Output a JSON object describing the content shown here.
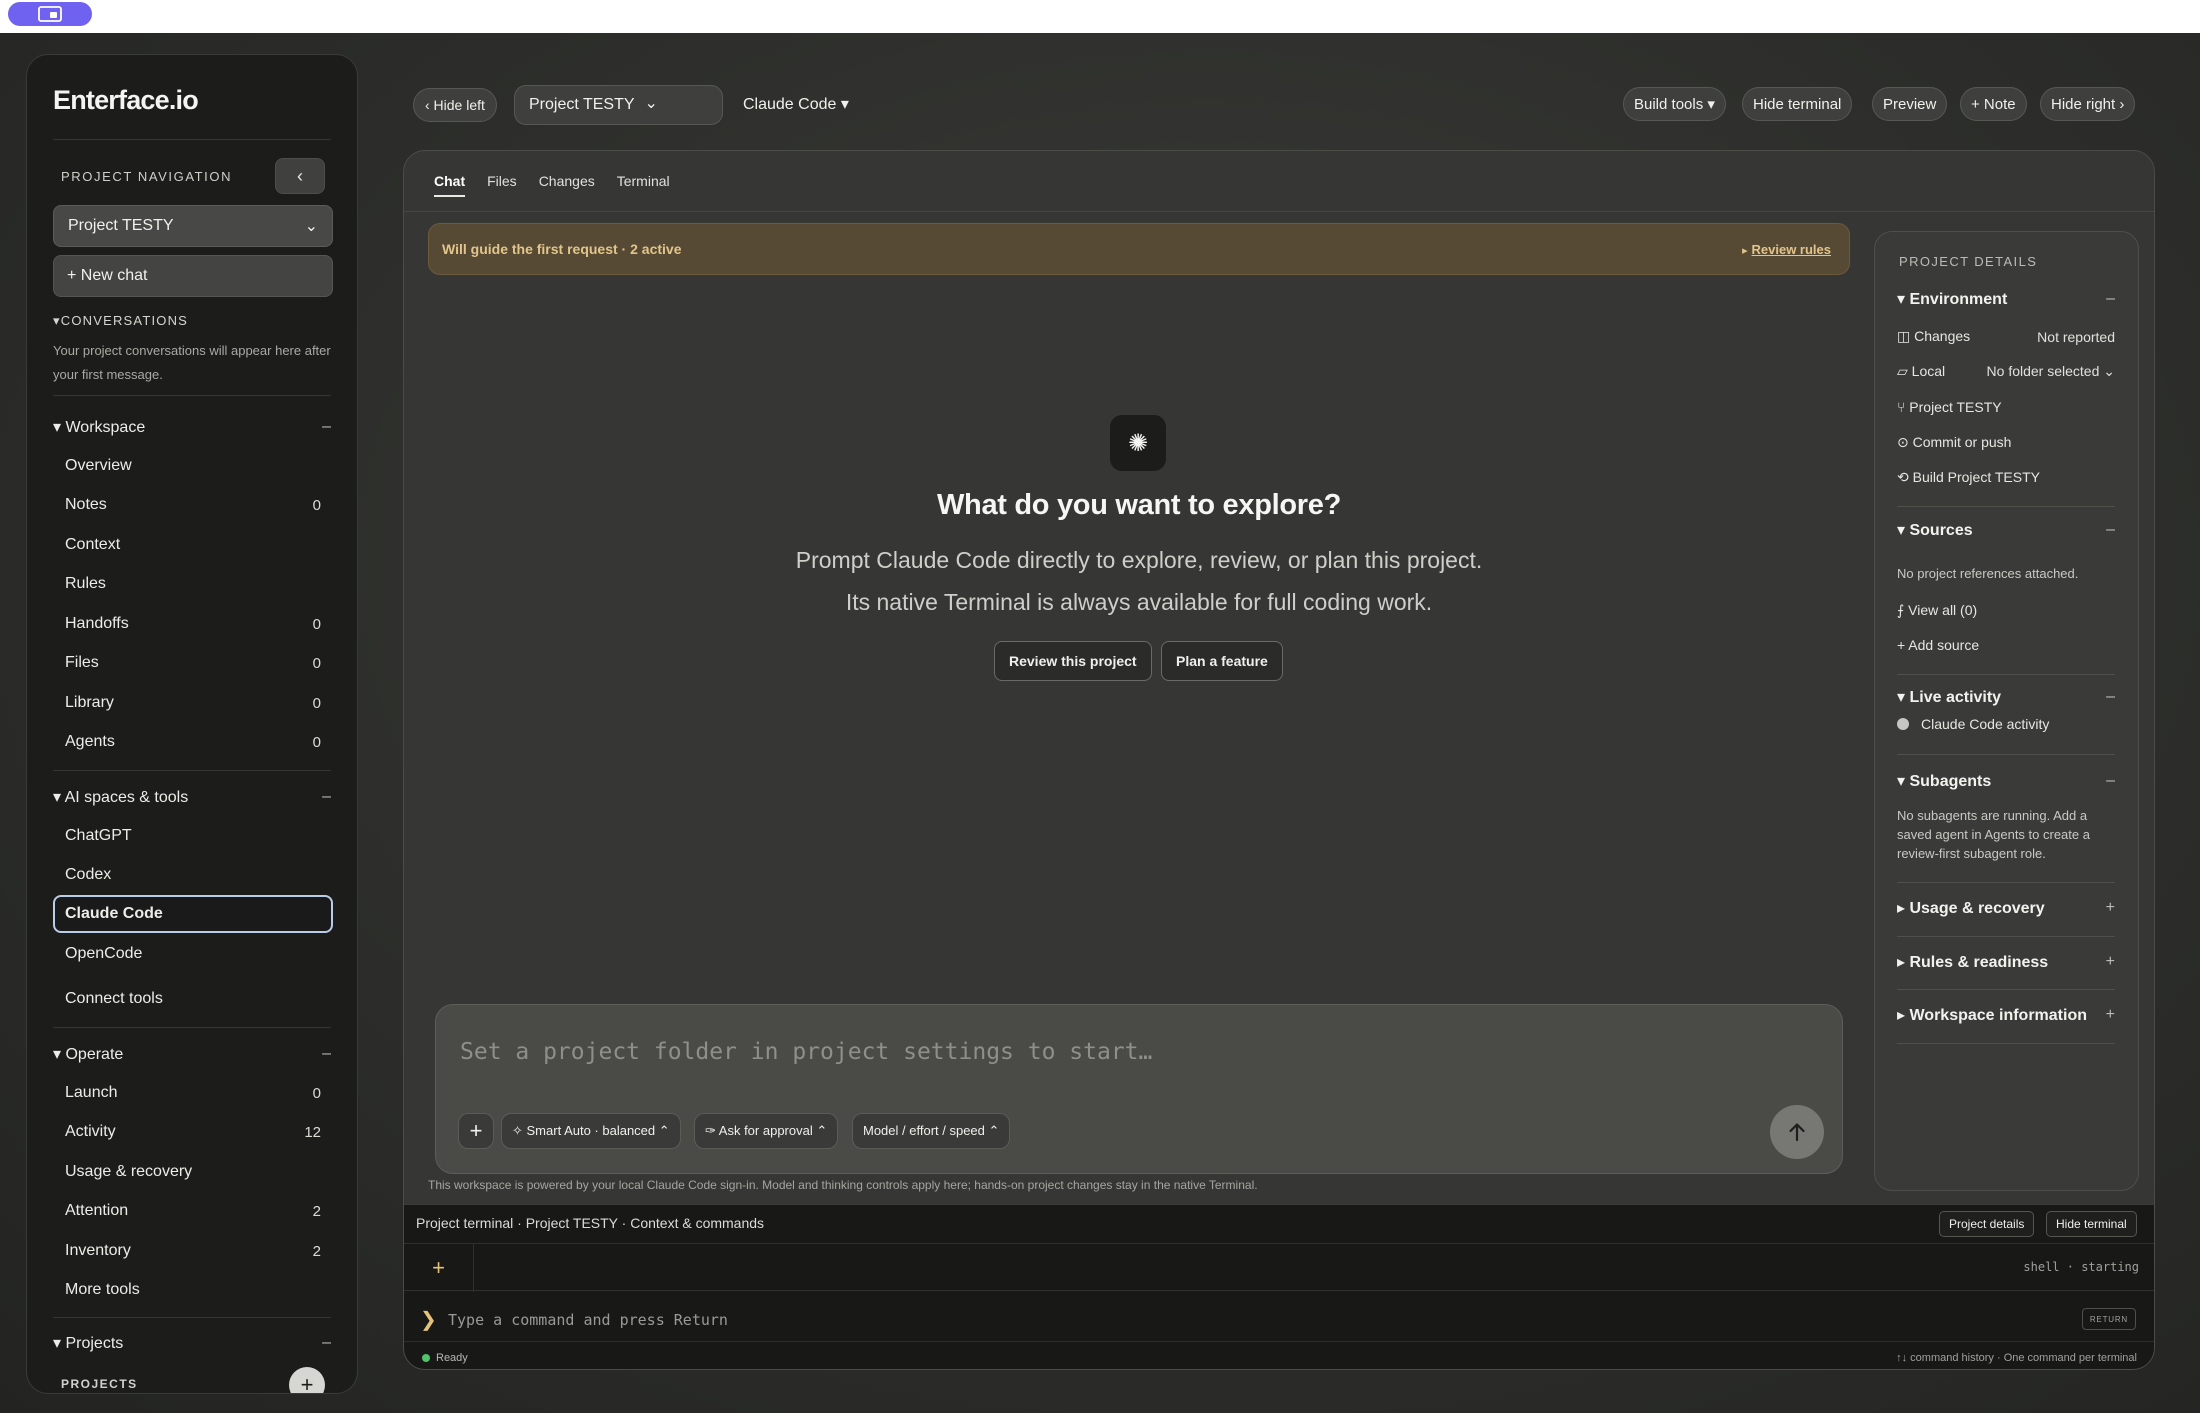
{
  "sidebar": {
    "logo": "Enterface.io",
    "nav_label": "PROJECT NAVIGATION",
    "collapse_glyph": "‹",
    "project_select": "Project TESTY",
    "new_chat": "+ New chat",
    "conversations_head": "▾CONVERSATIONS",
    "conversations_empty": "Your project conversations will appear here after your first message.",
    "workspace": {
      "title": "▾ Workspace",
      "collapse": "–",
      "items": [
        {
          "label": "Overview",
          "count": ""
        },
        {
          "label": "Notes",
          "count": "0"
        },
        {
          "label": "Context",
          "count": ""
        },
        {
          "label": "Rules",
          "count": ""
        },
        {
          "label": "Handoffs",
          "count": "0"
        },
        {
          "label": "Files",
          "count": "0"
        },
        {
          "label": "Library",
          "count": "0"
        },
        {
          "label": "Agents",
          "count": "0"
        }
      ]
    },
    "ai_spaces": {
      "title": "▾ AI spaces & tools",
      "collapse": "–",
      "items": [
        "ChatGPT",
        "Codex",
        "Claude Code",
        "OpenCode",
        "Connect tools"
      ]
    },
    "operate": {
      "title": "▾ Operate",
      "collapse": "–",
      "items": [
        {
          "label": "Launch",
          "count": "0"
        },
        {
          "label": "Activity",
          "count": "12"
        },
        {
          "label": "Usage & recovery",
          "count": ""
        },
        {
          "label": "Attention",
          "count": "2"
        },
        {
          "label": "Inventory",
          "count": "2"
        },
        {
          "label": "More tools",
          "count": ""
        }
      ]
    },
    "projects": {
      "title": "▾ Projects",
      "collapse": "–",
      "label": "PROJECTS",
      "add": "+"
    }
  },
  "toolbar": {
    "hide_left": "‹ Hide left",
    "project": "Project TESTY",
    "project_chevron": "⌄",
    "agent": "Claude Code ▾",
    "build_tools": "Build tools ▾",
    "hide_terminal": "Hide terminal",
    "preview": "Preview",
    "note": "+ Note",
    "hide_right": "Hide right ›"
  },
  "main": {
    "tabs": [
      "Chat",
      "Files",
      "Changes",
      "Terminal"
    ],
    "banner": {
      "text": "Will guide the first request · 2 active",
      "link_arrow": "▸",
      "link": "Review rules"
    },
    "hero": {
      "icon": "✺",
      "title": "What do you want to explore?",
      "line1": "Prompt Claude Code directly to explore, review, or plan this project.",
      "line2": "Its native Terminal is always available for full coding work.",
      "btn_review": "Review this project",
      "btn_plan": "Plan a feature"
    },
    "composer": {
      "placeholder": "Set a project folder in project settings to start…",
      "plus": "+",
      "chip_mode": "✧ Smart Auto · balanced ⌃",
      "chip_approval": "✑ Ask for approval ⌃",
      "chip_model": "Model / effort / speed ⌃"
    },
    "disclaimer": "This workspace is powered by your local Claude Code sign-in. Model and thinking controls apply here; hands-on project changes stay in the native Terminal."
  },
  "details": {
    "title": "PROJECT DETAILS",
    "environment": {
      "title": "▾ Environment",
      "sign": "–",
      "changes_label": "◫ Changes",
      "changes_value": "Not reported",
      "local_label": "▱ Local",
      "local_value": "No folder selected ⌄",
      "branch": "⑂ Project TESTY",
      "commit": "⊙ Commit or push",
      "build": "⟲ Build Project TESTY"
    },
    "sources": {
      "title": "▾ Sources",
      "sign": "–",
      "empty": "No project references attached.",
      "view_all": "⨍ View all (0)",
      "add": "+ Add source"
    },
    "live": {
      "title": "▾ Live activity",
      "sign": "–",
      "item": "Claude Code activity"
    },
    "subagents": {
      "title": "▾ Subagents",
      "sign": "–",
      "note": "No subagents are running. Add a saved agent in Agents to create a review-first subagent role."
    },
    "usage": {
      "title": "▸ Usage & recovery",
      "sign": "+"
    },
    "rules": {
      "title": "▸ Rules & readiness",
      "sign": "+"
    },
    "workspace": {
      "title": "▸ Workspace information",
      "sign": "+"
    }
  },
  "terminal": {
    "head": "Project terminal · Project TESTY · Context & commands",
    "project_details": "Project details",
    "hide_terminal": "Hide terminal",
    "plus": "+",
    "status": "shell · starting",
    "prompt": "❯",
    "placeholder": "Type a command and press Return",
    "return_key": "RETURN",
    "ready": "Ready",
    "history": "↑↓ command history · One command per terminal"
  }
}
